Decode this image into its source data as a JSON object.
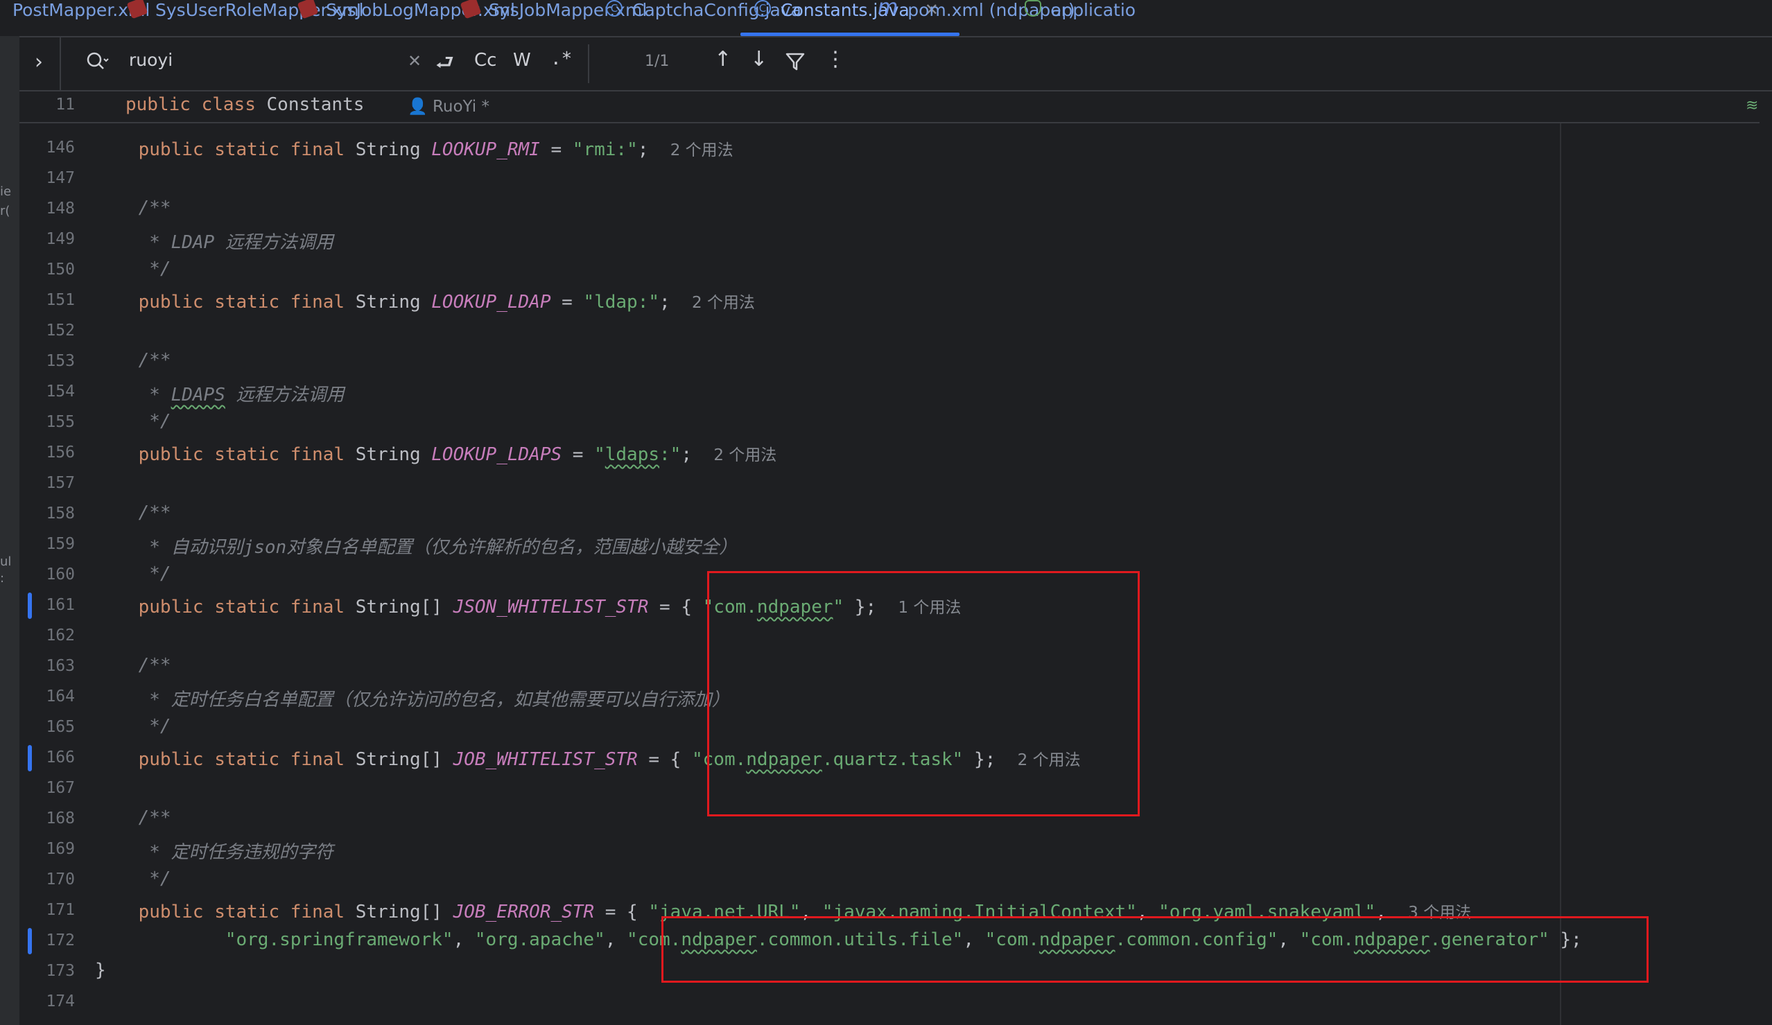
{
  "tabs": [
    {
      "label": "PostMapper.xml",
      "icon": "xml-file-icon"
    },
    {
      "label": "SysUserRoleMapper.xml",
      "icon": "xml-file-icon"
    },
    {
      "label": "SysJobLogMapper.xml",
      "icon": "xml-file-icon"
    },
    {
      "label": "SysJobMapper.xml",
      "icon": "xml-file-icon"
    },
    {
      "label": "CaptchaConfig.java",
      "icon": "java-class-icon"
    },
    {
      "label": "Constants.java",
      "icon": "java-class-icon",
      "active": true
    },
    {
      "label": "pom.xml (ndpaper)",
      "icon": "maven-icon"
    },
    {
      "label": "applicatio",
      "icon": "spring-config-icon"
    }
  ],
  "left_strip_fragments": [
    "ie",
    "r(",
    "ul",
    ":"
  ],
  "search": {
    "query": "ruoyi",
    "match_count": "1/1",
    "match_case_label": "Cc",
    "words_label": "W",
    "regex_label": ".*"
  },
  "sticky_header": {
    "line_number": "11",
    "code": "public class Constants",
    "author": "RuoYi *"
  },
  "code_lines": [
    {
      "n": "146",
      "t": "decl_rmi"
    },
    {
      "n": "147"
    },
    {
      "n": "148"
    },
    {
      "n": "149"
    },
    {
      "n": "150"
    },
    {
      "n": "151"
    },
    {
      "n": "152"
    },
    {
      "n": "153"
    },
    {
      "n": "154"
    },
    {
      "n": "155"
    },
    {
      "n": "156"
    },
    {
      "n": "157"
    },
    {
      "n": "158"
    },
    {
      "n": "159"
    },
    {
      "n": "160"
    },
    {
      "n": "161"
    },
    {
      "n": "162"
    },
    {
      "n": "163"
    },
    {
      "n": "164"
    },
    {
      "n": "165"
    },
    {
      "n": "166"
    },
    {
      "n": "167"
    },
    {
      "n": "168"
    },
    {
      "n": "169"
    },
    {
      "n": "170"
    },
    {
      "n": "171"
    },
    {
      "n": "172"
    },
    {
      "n": "173"
    },
    {
      "n": "174"
    }
  ],
  "code": {
    "kw_public_static_final": "public static final",
    "kw_public": "public",
    "kw_class": "class",
    "type_string": "String",
    "type_string_arr": "String[]",
    "eq": "=",
    "rmi_name": "LOOKUP_RMI",
    "rmi_value": "\"rmi:\"",
    "rmi_hint": "2 个用法",
    "ldap_name": "LOOKUP_LDAP",
    "ldap_value": "\"ldap:\"",
    "ldap_hint": "2 个用法",
    "ldaps_name": "LOOKUP_LDAPS",
    "ldaps_value": "\"ldaps:\"",
    "ldaps_hint": "2 个用法",
    "json_name": "JSON_WHITELIST_STR",
    "json_value": "\"com.ndpaper\"",
    "json_hint": "1 个用法",
    "job_name": "JOB_WHITELIST_STR",
    "job_value": "\"com.ndpaper.quartz.task\"",
    "job_hint": "2 个用法",
    "err_name": "JOB_ERROR_STR",
    "err_values_1": [
      "\"java.net.URL\"",
      "\"javax.naming.InitialContext\"",
      "\"org.yaml.snakeyaml\""
    ],
    "err_hint": "3 个用法",
    "err_values_2": [
      "\"org.springframework\"",
      "\"org.apache\"",
      "\"com.ndpaper.common.utils.file\"",
      "\"com.ndpaper.common.config\"",
      "\"com.ndpaper.generator\""
    ],
    "doc_open": "/**",
    "doc_close": "*/",
    "ldap_doc": "* LDAP 远程方法调用",
    "ldaps_doc_star": "* ",
    "ldaps_doc_word": "LDAPS",
    "ldaps_doc_rest": " 远程方法调用",
    "json_doc": "* 自动识别json对象白名单配置（仅允许解析的包名，范围越小越安全）",
    "job_doc": "* 定时任务白名单配置（仅允许访问的包名，如其他需要可以自行添加）",
    "err_doc": "* 定时任务违规的字符",
    "close_brace": "}"
  },
  "colors": {
    "keyword": "#cf8e6d",
    "constant": "#c77dbb",
    "string": "#6aab73",
    "comment": "#7a7e85",
    "highlight_box": "#e0191e",
    "active_tab_underline": "#3574f0"
  }
}
